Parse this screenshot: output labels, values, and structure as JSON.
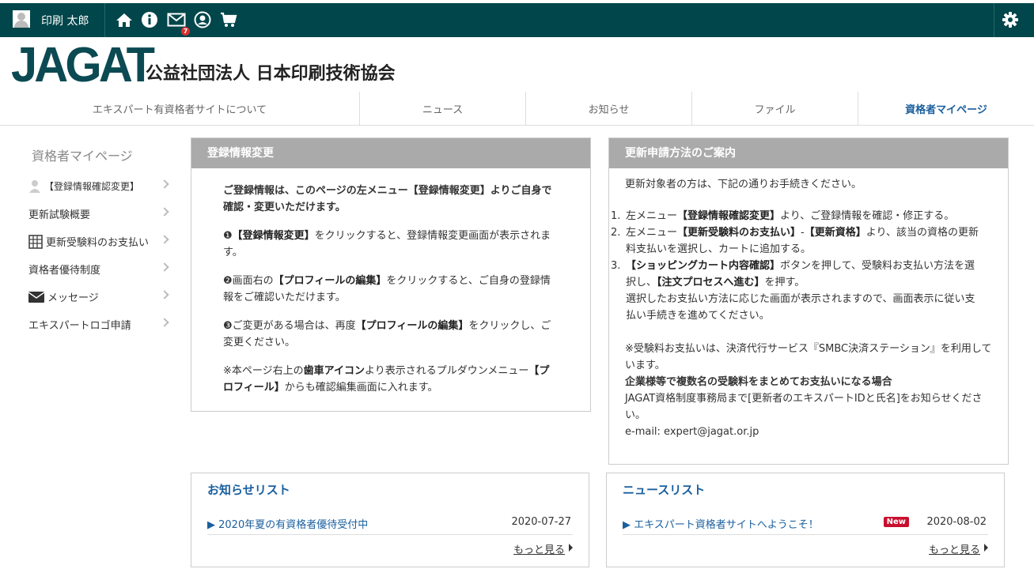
{
  "topbar": {
    "username": "印刷 太郎",
    "mail_count": "7"
  },
  "brand": {
    "logo_text": "JAGAT",
    "org_name": "公益社団法人 日本印刷技術協会"
  },
  "nav": {
    "items": [
      {
        "label": "エキスパート有資格者サイトについて"
      },
      {
        "label": "ニュース"
      },
      {
        "label": "お知らせ"
      },
      {
        "label": "ファイル"
      },
      {
        "label": "資格者マイページ"
      }
    ]
  },
  "sidebar": {
    "title": "資格者マイページ",
    "items": [
      {
        "label": "【登録情報確認変更】"
      },
      {
        "label": "更新試験概要"
      },
      {
        "label": "更新受験料のお支払い"
      },
      {
        "label": "資格者優待制度"
      },
      {
        "label": "メッセージ"
      },
      {
        "label": "エキスパートロゴ申請"
      }
    ]
  },
  "reg_panel": {
    "title": "登録情報変更",
    "intro": "ご登録情報は、このページの左メニュー【登録情報変更】よりご自身で確認・変更いただけます。",
    "step1_a": "❶",
    "step1_b": "【登録情報変更】",
    "step1_c": "をクリックすると、登録情報変更画面が表示されます。",
    "step2_a": "❷画面右の",
    "step2_b": "【プロフィールの編集】",
    "step2_c": "をクリックすると、ご自身の登録情報をご確認いただけます。",
    "step3_a": "❸ご変更がある場合は、再度",
    "step3_b": "【プロフィールの編集】",
    "step3_c": "をクリックし、ご変更ください。",
    "note_a": "※本ページ右上の",
    "note_b": "歯車アイコン",
    "note_c": "より表示されるプルダウンメニュー",
    "note_d": "【プロフィール】",
    "note_e": "からも確認編集画面に入れます。"
  },
  "renew_panel": {
    "title": "更新申請方法のご案内",
    "intro": "更新対象者の方は、下記の通りお手続きください。",
    "s1_n": "1.",
    "s1_a": "左メニュー",
    "s1_b": "【登録情報確認変更】",
    "s1_c": "より、ご登録情報を確認・修正する。",
    "s2_n": "2.",
    "s2_a": "左メニュー",
    "s2_b": "【更新受験料のお支払い】",
    "s2_c": "-",
    "s2_d": "【更新資格】",
    "s2_e": "より、該当の資格の更新料支払いを選択し、カートに追加する。",
    "s3_n": "3.",
    "s3_a": "【ショッピングカート内容確認】",
    "s3_b": "ボタンを押して、受験料お支払い方法を選択し、",
    "s3_c": "【注文プロセスへ進む】",
    "s3_d": "を押す。",
    "s3_e": "選択したお支払い方法に応じた画面が表示されますので、画面表示に従い支払い手続きを進めてください。",
    "note": "※受験料お支払いは、決済代行サービス『SMBC決済ステーション』を利用しています。",
    "corp": "企業様等で複数名の受験料をまとめてお支払いになる場合",
    "corp_desc": "JAGAT資格制度事務局まで[更新者のエキスパートIDと氏名]をお知らせください。",
    "email": "e-mail: expert@jagat.or.jp"
  },
  "notice_list": {
    "title": "お知らせリスト",
    "item": "▶ 2020年夏の有資格者優待受付中",
    "date": "2020-07-27",
    "more": "もっと見る"
  },
  "news_list": {
    "title": "ニュースリスト",
    "item": "▶ エキスパート資格者サイトへようこそ！",
    "badge": "New",
    "date": "2020-08-02",
    "more": "もっと見る"
  }
}
